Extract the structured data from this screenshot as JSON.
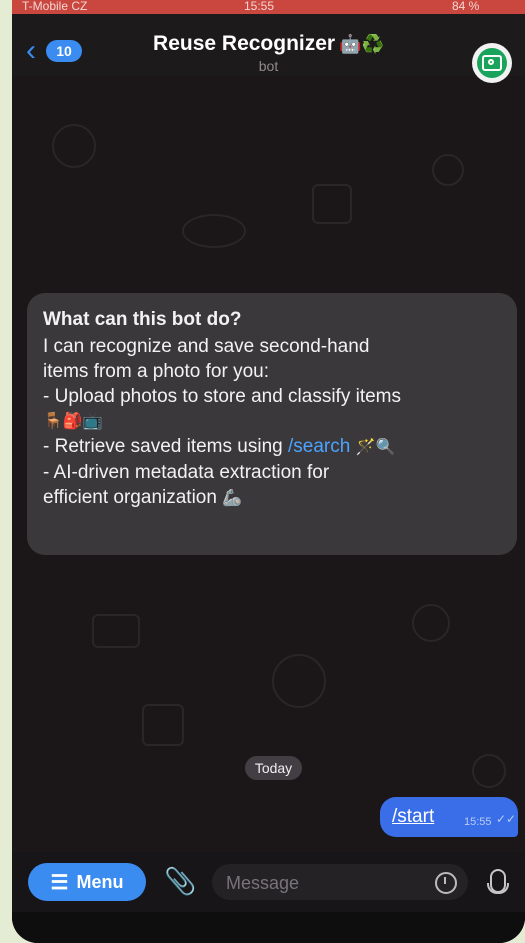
{
  "status_bar": {
    "carrier": "T-Mobile CZ",
    "time": "15:55",
    "battery": "84 %"
  },
  "header": {
    "back_count": "10",
    "title": "Reuse Recognizer",
    "title_emoji": "🤖♻️",
    "subtitle": "bot"
  },
  "bot_info": {
    "heading": "What can this bot do?",
    "lines": [
      "I can recognize and save second-hand",
      "items from a photo for you:",
      " - Upload photos to store and classify items",
      "🪑🎒📺",
      " - Retrieve saved items using ",
      " - AI-driven metadata extraction for",
      "efficient organization "
    ],
    "search_command": "/search",
    "search_emoji": "🪄🔍",
    "org_emoji": "🦾"
  },
  "date_separator": "Today",
  "outgoing_message": {
    "text": "/start",
    "time": "15:55",
    "status": "✓✓"
  },
  "input_bar": {
    "menu_label": "Menu",
    "placeholder": "Message"
  },
  "colors": {
    "accent": "#3a8cf0",
    "bubble_out": "#3a6ee8",
    "status_bar": "#c9473f"
  }
}
